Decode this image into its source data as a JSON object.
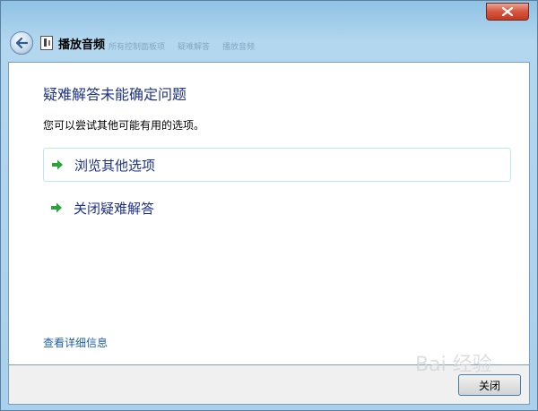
{
  "window": {
    "title": "播放音频",
    "breadcrumbs": [
      "所有控制面板项",
      "疑难解答",
      "播放音频"
    ]
  },
  "content": {
    "heading": "疑难解答未能确定问题",
    "subtext": "您可以尝试其他可能有用的选项。",
    "options": [
      {
        "label": "浏览其他选项",
        "highlighted": true
      },
      {
        "label": "关闭疑难解答",
        "highlighted": false
      }
    ],
    "details_link": "查看详细信息"
  },
  "footer": {
    "close_label": "关闭"
  },
  "watermark": "Bai 经验",
  "colors": {
    "heading": "#1e3287",
    "arrow": "#2aa33a",
    "link": "#1e5fa8"
  },
  "icons": {
    "back": "back-arrow-icon",
    "close": "close-x-icon",
    "option_arrow": "green-arrow-icon",
    "app": "audio-troubleshooter-icon"
  }
}
